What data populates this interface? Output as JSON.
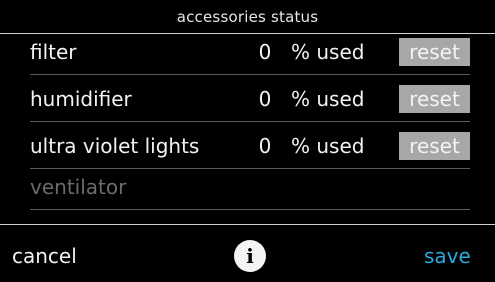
{
  "screen": {
    "title": "accessories status"
  },
  "accessories": [
    {
      "label": "filter",
      "value": "0",
      "unit": "% used",
      "action": "reset"
    },
    {
      "label": "humidifier",
      "value": "0",
      "unit": "% used",
      "action": "reset"
    },
    {
      "label": "ultra violet lights",
      "value": "0",
      "unit": "% used",
      "action": "reset"
    },
    {
      "label": "ventilator"
    }
  ],
  "footer": {
    "cancel_label": "cancel",
    "info_label": "i",
    "save_label": "save"
  },
  "colors": {
    "background": "#000000",
    "reset_button": "#a7a7a7",
    "save_accent": "#2aa8e2",
    "disabled_text": "#6b6b6b"
  },
  "icons": {
    "info": "info-icon"
  }
}
